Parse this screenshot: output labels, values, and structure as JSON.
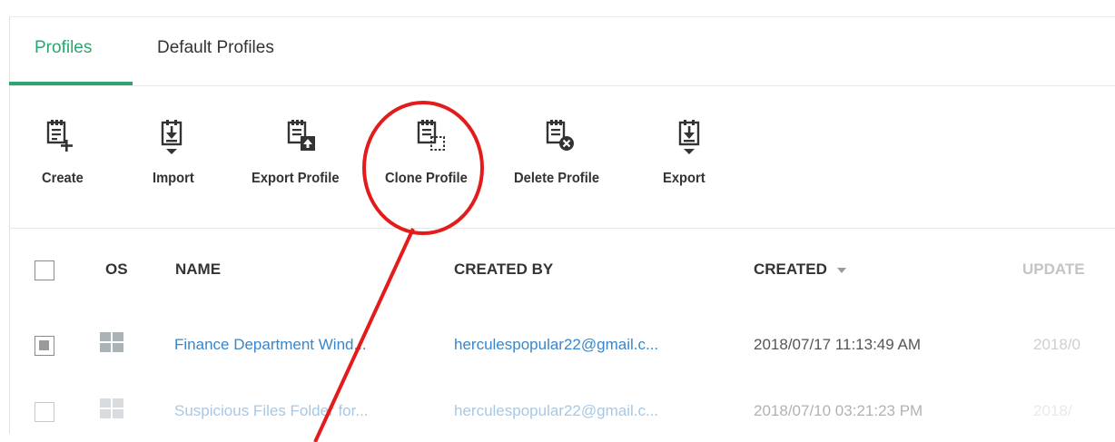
{
  "tabs": {
    "profiles": "Profiles",
    "default_profiles": "Default Profiles",
    "active": "Profiles"
  },
  "toolbar": {
    "create": "Create",
    "import": "Import",
    "export_profile": "Export Profile",
    "clone_profile": "Clone Profile",
    "delete_profile": "Delete Profile",
    "export": "Export"
  },
  "table": {
    "headers": {
      "os": "OS",
      "name": "NAME",
      "created_by": "CREATED BY",
      "created": "CREATED",
      "updated": "UPDATE"
    },
    "rows": [
      {
        "name": "Finance Department Wind...",
        "created_by": "herculespopular22@gmail.c...",
        "created": "2018/07/17 11:13:49 AM",
        "updated": "2018/0",
        "os_icon": "windows-icon",
        "checked": true
      },
      {
        "name": "Suspicious Files Folder for...",
        "created_by": "herculespopular22@gmail.c...",
        "created": "2018/07/10 03:21:23 PM",
        "updated": "2018/",
        "os_icon": "windows-icon",
        "checked": false
      }
    ]
  },
  "colors": {
    "accent": "#2aa66e",
    "link": "#3a86c8",
    "annotation": "#e31b1b"
  }
}
